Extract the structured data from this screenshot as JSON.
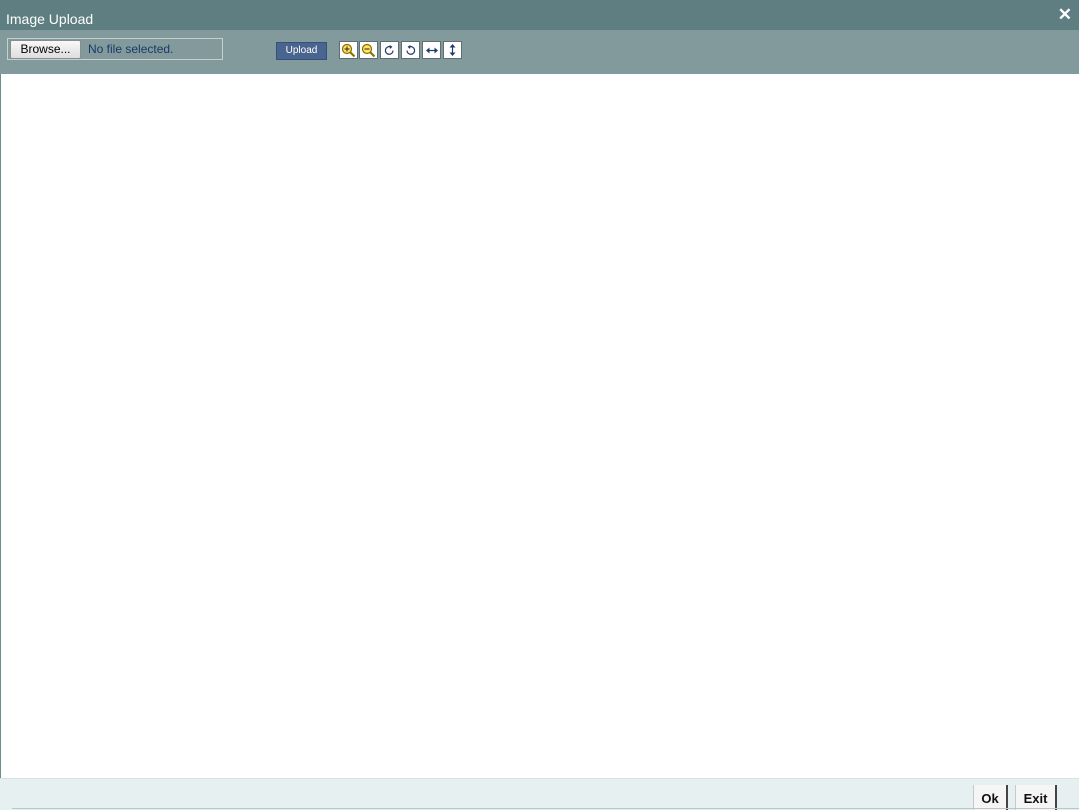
{
  "window": {
    "title": "Image Upload",
    "close_glyph": "✕"
  },
  "file_picker": {
    "button_label": "Browse...",
    "status": "No file selected."
  },
  "toolbar": {
    "upload_label": "Upload",
    "tools": [
      {
        "name": "zoom-in-icon"
      },
      {
        "name": "zoom-out-icon"
      },
      {
        "name": "rotate-clockwise-icon"
      },
      {
        "name": "rotate-counterclockwise-icon"
      },
      {
        "name": "flip-horizontal-icon"
      },
      {
        "name": "flip-vertical-icon"
      }
    ]
  },
  "footer": {
    "ok_label": "Ok",
    "exit_label": "Exit"
  },
  "colors": {
    "titlebar": "#5f7e81",
    "toolbar": "#839a9c",
    "upload_button": "#48648f",
    "footer": "#e6f0f0"
  }
}
